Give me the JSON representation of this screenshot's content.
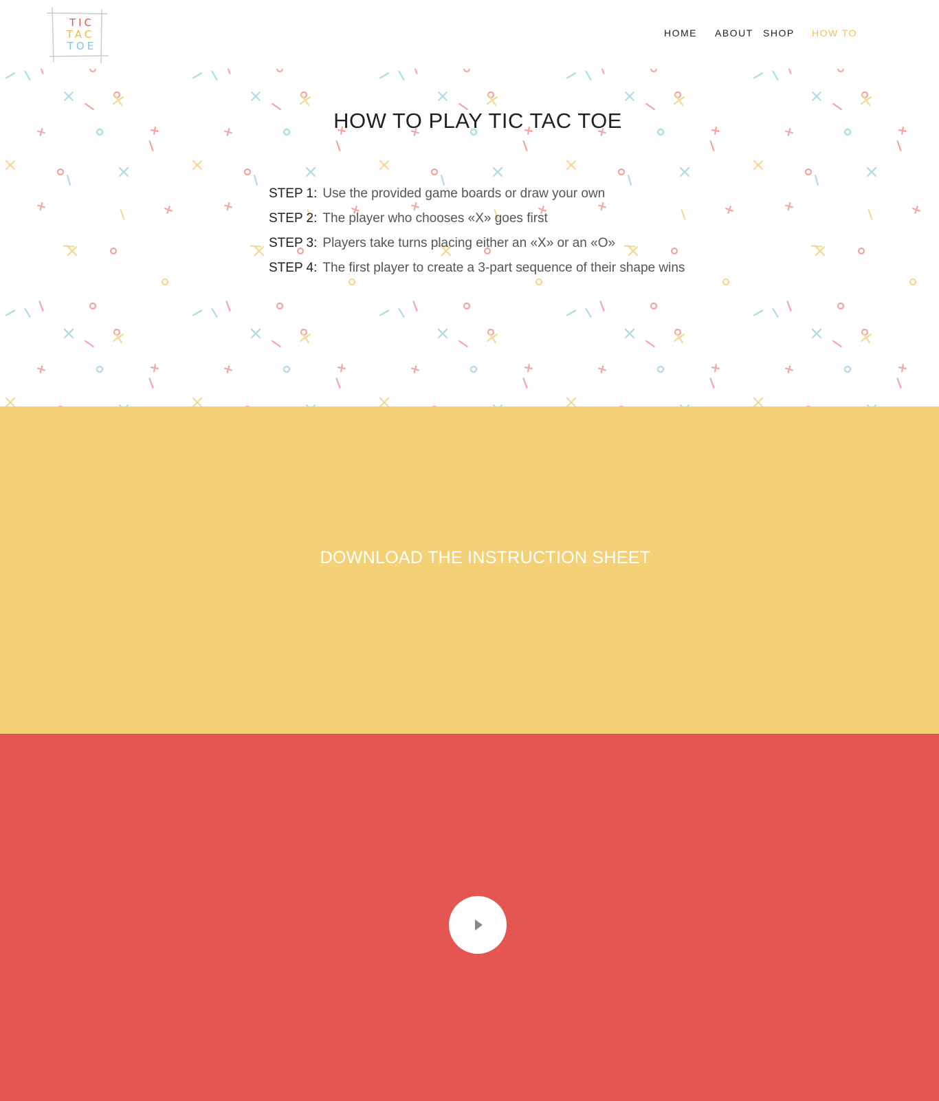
{
  "logo": {
    "lines": [
      "TIC",
      "TAC",
      "TOE"
    ]
  },
  "nav": {
    "items": [
      {
        "label": "HOME"
      },
      {
        "label": "ABOUT"
      },
      {
        "label": "SHOP"
      },
      {
        "label": "HOW TO"
      }
    ],
    "active": "HOW TO"
  },
  "hero": {
    "title": "HOW TO PLAY TIC TAC TOE",
    "steps": [
      {
        "label": "STEP 1:",
        "text": "Use the provided game boards or draw your own"
      },
      {
        "label": "STEP 2:",
        "text": "The player who chooses «X» goes first"
      },
      {
        "label": "STEP 3:",
        "text": "Players take turns placing either an «X» or an «O»"
      },
      {
        "label": "STEP 4:",
        "text": "The first player to create a 3-part sequence of their shape wins"
      }
    ]
  },
  "download": {
    "label": "DOWNLOAD THE INSTRUCTION SHEET"
  },
  "colors": {
    "accent_yellow": "#f4d177",
    "accent_red": "#e55652",
    "nav_active": "#f3c05b",
    "pattern": [
      "#f2a5a3",
      "#f6d792",
      "#a9dee5"
    ]
  },
  "video": {
    "play_icon": "play-icon"
  }
}
